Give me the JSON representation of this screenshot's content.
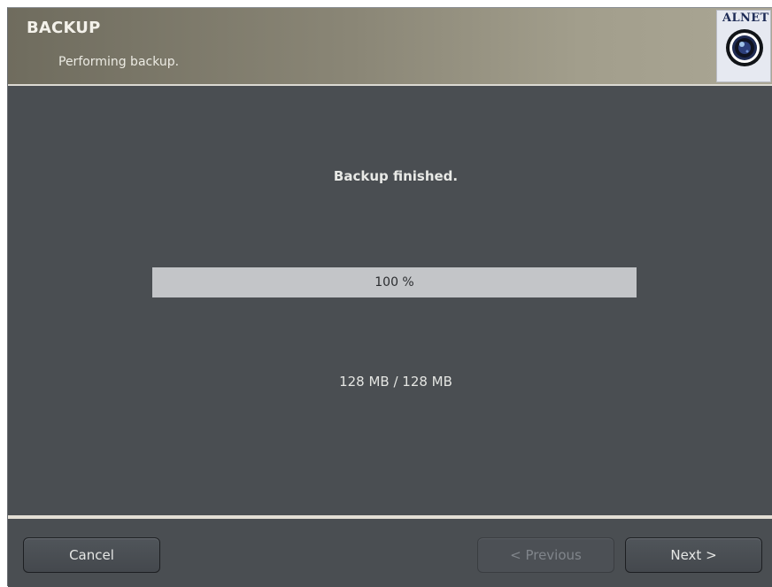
{
  "header": {
    "title": "BACKUP",
    "subtitle": "Performing backup."
  },
  "logo": {
    "text": "ALNET",
    "icon": "camera-lens-icon"
  },
  "main": {
    "status_message": "Backup finished.",
    "progress": {
      "value_percent": 100,
      "label": "100 %"
    },
    "size_label": "128 MB / 128 MB"
  },
  "footer": {
    "cancel_label": "Cancel",
    "previous_label": "< Previous",
    "previous_enabled": false,
    "next_label": "Next >"
  }
}
